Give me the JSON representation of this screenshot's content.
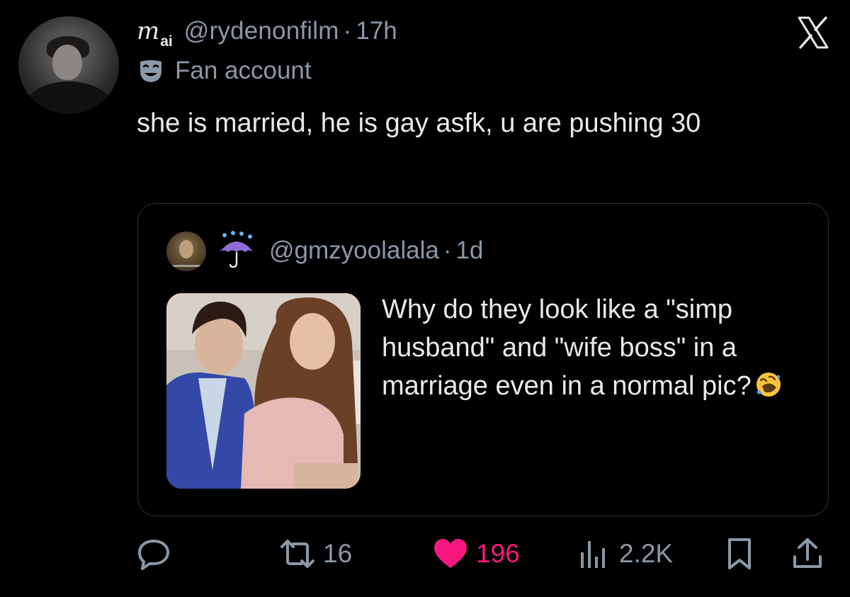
{
  "tweet": {
    "display_name": "m",
    "display_name_sub": "ai",
    "handle": "@rydenonfilm",
    "separator": "·",
    "time": "17h",
    "affiliation_label": "Fan account",
    "text": "she is married, he is gay asfk, u are pushing 30"
  },
  "quote": {
    "handle": "@gmzyoolalala",
    "separator": "·",
    "time": "1d",
    "text": "Why do they look like a \"simp husband\" and \"wife boss\" in a marriage even in a normal pic?",
    "emoji": "rolling-on-the-floor-laughing"
  },
  "actions": {
    "replies": "",
    "retweets": "16",
    "likes": "196",
    "views": "2.2K"
  },
  "colors": {
    "background": "#000000",
    "text_primary": "#e7e9ea",
    "text_secondary": "#8b98a5",
    "like_pink": "#f91880",
    "border": "#2f3336"
  },
  "icons": [
    "x-logo-icon",
    "fan-mask-icon",
    "umbrella-emoji-icon",
    "reply-icon",
    "retweet-icon",
    "heart-icon",
    "views-icon",
    "bookmark-icon",
    "share-icon"
  ]
}
